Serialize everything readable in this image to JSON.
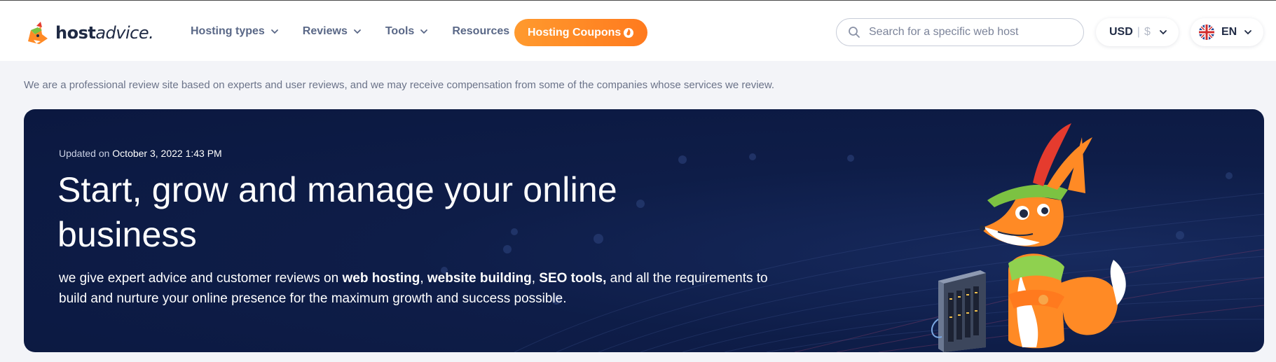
{
  "header": {
    "logo": {
      "bold": "host",
      "light": "advice."
    },
    "nav": [
      {
        "label": "Hosting types"
      },
      {
        "label": "Reviews"
      },
      {
        "label": "Tools"
      },
      {
        "label": "Resources"
      }
    ],
    "coupons_label": "Hosting Coupons",
    "search": {
      "placeholder": "Search for a specific web host",
      "value": ""
    },
    "currency": {
      "code": "USD",
      "symbol": "$"
    },
    "language": {
      "code": "EN"
    }
  },
  "disclaimer": "We are a professional review site based on experts and user reviews, and we may receive compensation from some of the companies whose services we review.",
  "hero": {
    "updated_prefix": "Updated on",
    "updated_date": "October 3, 2022 1:43 PM",
    "title": "Start, grow and manage your online business",
    "desc": {
      "p1": "we give expert advice and customer reviews on ",
      "b1": "web hosting",
      "p2": ", ",
      "b2": "website building",
      "p3": ", ",
      "b3": "SEO tools,",
      "p4": " and all the requirements to build and nurture your online presence for the maximum growth and success possible."
    }
  },
  "colors": {
    "accent_orange": "#ff8a25",
    "hero_bg": "#0e1d48",
    "nav_text": "#5a6887",
    "page_bg": "#f3f4f8"
  },
  "icons": [
    "logo-fox-icon",
    "chevron-down-icon",
    "flame-icon",
    "search-icon",
    "uk-flag-icon",
    "fox-mascot",
    "server-icon"
  ]
}
